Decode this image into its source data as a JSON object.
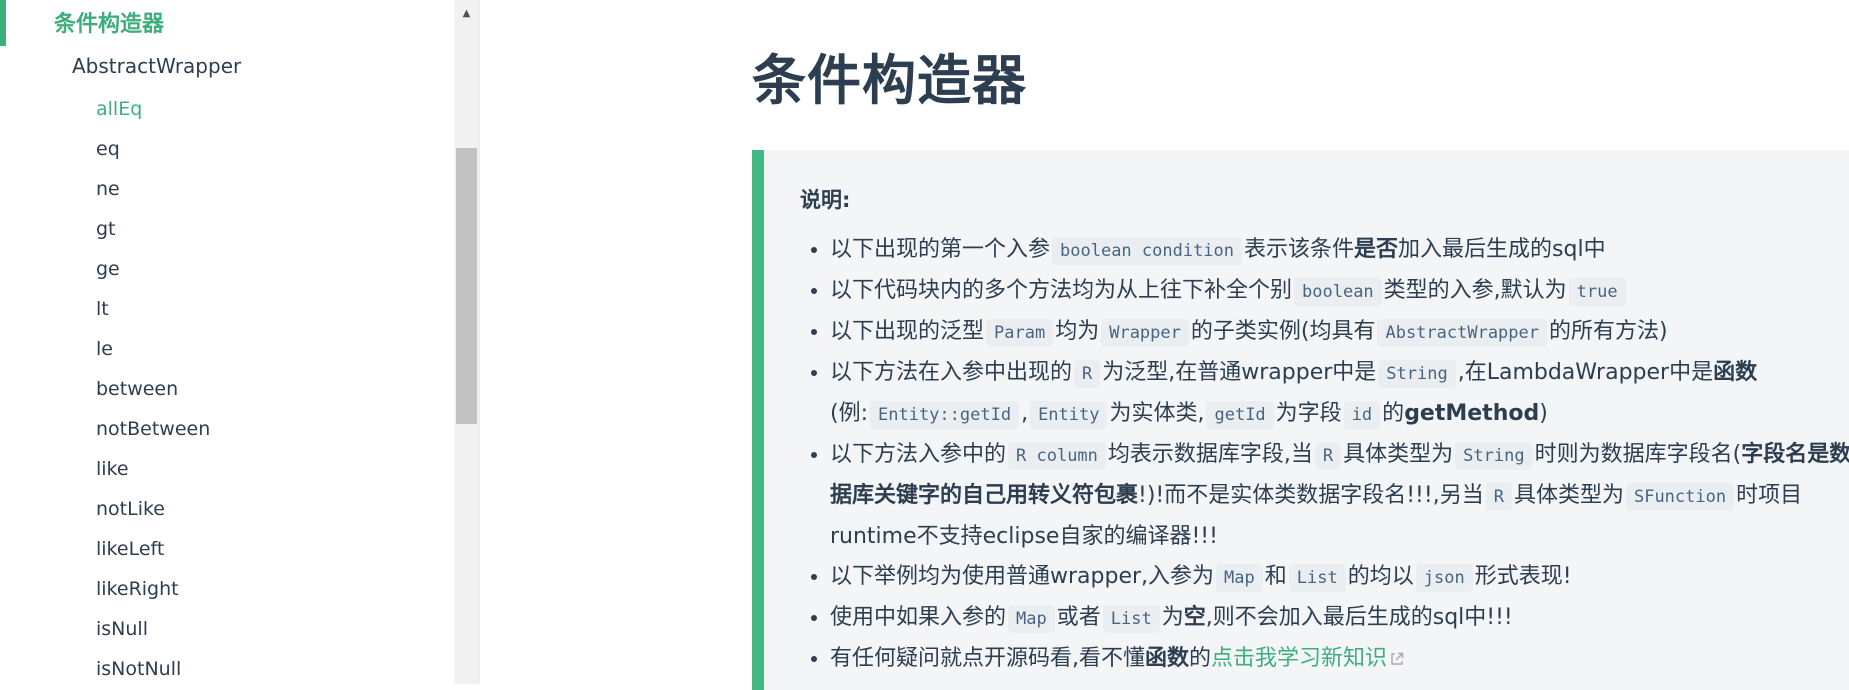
{
  "sidebar": {
    "section_title": "条件构造器",
    "group_title": "AbstractWrapper",
    "items": [
      {
        "label": "allEq",
        "active": true
      },
      {
        "label": "eq"
      },
      {
        "label": "ne"
      },
      {
        "label": "gt"
      },
      {
        "label": "ge"
      },
      {
        "label": "lt"
      },
      {
        "label": "le"
      },
      {
        "label": "between"
      },
      {
        "label": "notBetween"
      },
      {
        "label": "like"
      },
      {
        "label": "notLike"
      },
      {
        "label": "likeLeft"
      },
      {
        "label": "likeRight"
      },
      {
        "label": "isNull"
      },
      {
        "label": "isNotNull"
      }
    ]
  },
  "main": {
    "title": "条件构造器",
    "tip": {
      "heading": "说明:",
      "b1": {
        "t1": "以下出现的第一个入参",
        "c1": "boolean condition",
        "t2": "表示该条件",
        "strong": "是否",
        "t3": "加入最后生成的sql中"
      },
      "b2": {
        "t1": "以下代码块内的多个方法均为从上往下补全个别",
        "c1": "boolean",
        "t2": "类型的入参,默认为",
        "c2": "true"
      },
      "b3": {
        "t1": "以下出现的泛型",
        "c1": "Param",
        "t2": "均为",
        "c2": "Wrapper",
        "t3": "的子类实例(均具有",
        "c3": "AbstractWrapper",
        "t4": "的所有方法)"
      },
      "b4": {
        "t1": "以下方法在入参中出现的",
        "c1": "R",
        "t2": "为泛型,在普通wrapper中是",
        "c2": "String",
        "t3": ",在LambdaWrapper中是",
        "strong1": "函数",
        "t4": "(例:",
        "c3": "Entity::getId",
        "t5": ",",
        "c4": "Entity",
        "t6": "为实体类,",
        "c5": "getId",
        "t7": "为字段",
        "c6": "id",
        "t8": "的",
        "strong2": "getMethod",
        "t9": ")"
      },
      "b5": {
        "t1": "以下方法入参中的",
        "c1": "R column",
        "t2": "均表示数据库字段,当",
        "c2": "R",
        "t3": "具体类型为",
        "c3": "String",
        "t4": "时则为数据库字段名(",
        "strong": "字段名是数据库关键字的自己用转义符包裹",
        "t5": "!)!而不是实体类数据字段名!!!,另当",
        "c4": "R",
        "t6": "具体类型为",
        "c5": "SFunction",
        "t7": "时项目runtime不支持eclipse自家的编译器!!!"
      },
      "b6": {
        "t1": "以下举例均为使用普通wrapper,入参为",
        "c1": "Map",
        "t2": "和",
        "c2": "List",
        "t3": "的均以",
        "c3": "json",
        "t4": "形式表现!"
      },
      "b7": {
        "t1": "使用中如果入参的",
        "c1": "Map",
        "t2": "或者",
        "c2": "List",
        "t3": "为",
        "strong": "空",
        "t4": ",则不会加入最后生成的sql中!!!"
      },
      "b8": {
        "t1": "有任何疑问就点开源码看,看不懂",
        "strong": "函数",
        "t2": "的",
        "link": "点击我学习新知识"
      }
    }
  },
  "colors": {
    "accent": "#3eaf7c",
    "text": "#2c3e50",
    "code_text": "#476582",
    "tip_bg": "#f3f5f7"
  },
  "icons": {
    "scroll_up": "triangle-up-icon",
    "external": "external-link-icon"
  }
}
